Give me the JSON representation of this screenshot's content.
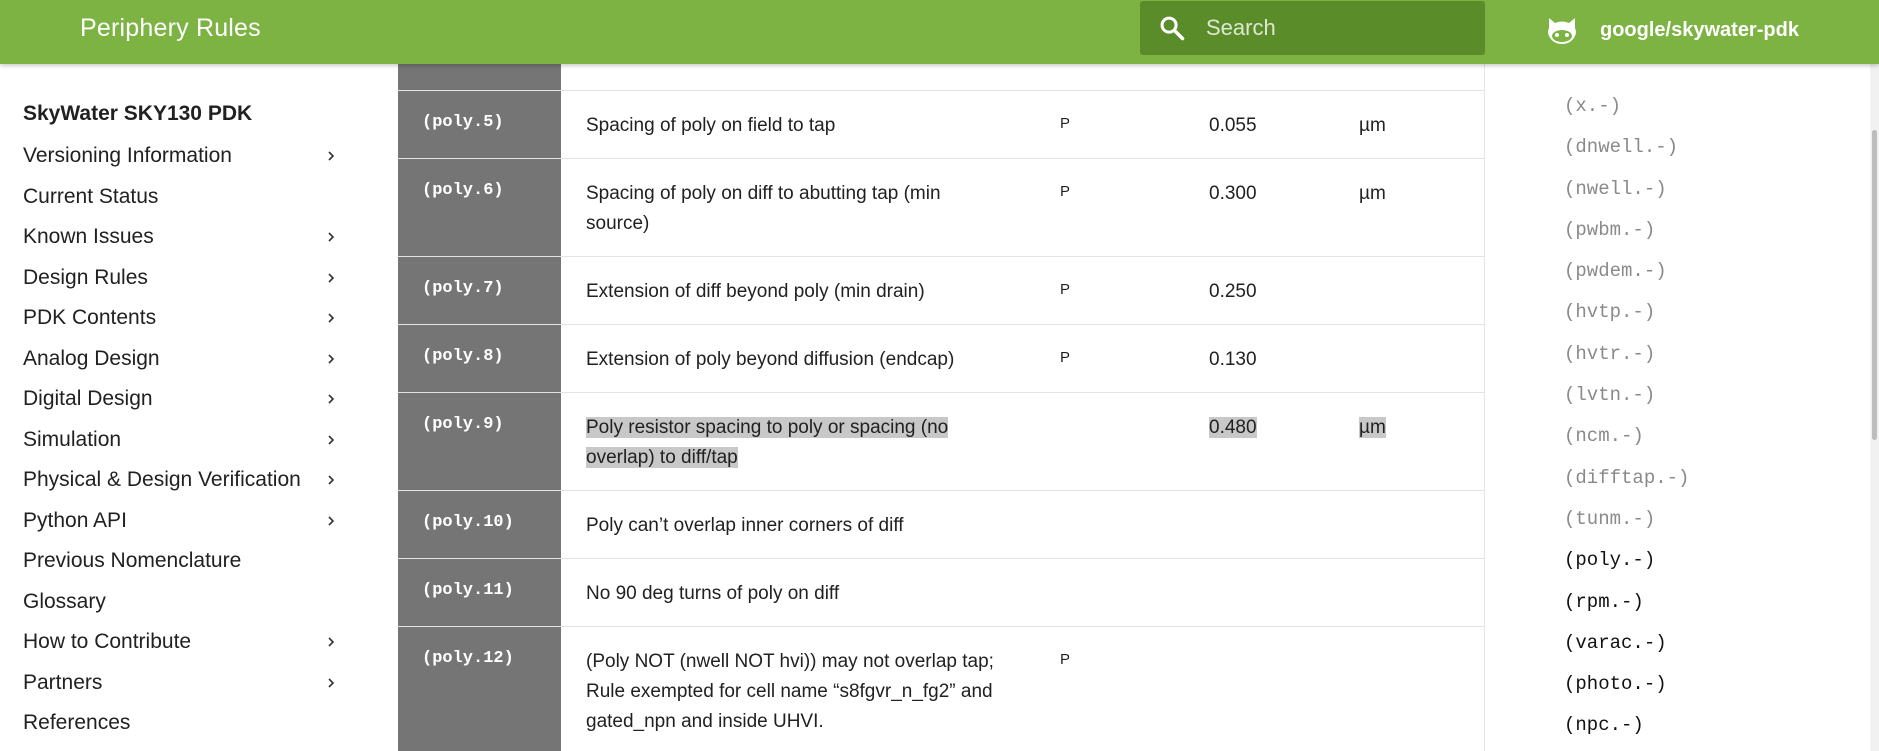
{
  "header": {
    "title": "Periphery Rules",
    "search_placeholder": "Search",
    "repo": "google/skywater-pdk"
  },
  "nav": {
    "site_title": "SkyWater SKY130 PDK",
    "items": [
      {
        "label": "Versioning Information",
        "expandable": true
      },
      {
        "label": "Current Status",
        "expandable": false
      },
      {
        "label": "Known Issues",
        "expandable": true
      },
      {
        "label": "Design Rules",
        "expandable": true
      },
      {
        "label": "PDK Contents",
        "expandable": true
      },
      {
        "label": "Analog Design",
        "expandable": true
      },
      {
        "label": "Digital Design",
        "expandable": true
      },
      {
        "label": "Simulation",
        "expandable": true
      },
      {
        "label": "Physical & Design Verification",
        "expandable": true
      },
      {
        "label": "Python API",
        "expandable": true
      },
      {
        "label": "Previous Nomenclature",
        "expandable": false
      },
      {
        "label": "Glossary",
        "expandable": false
      },
      {
        "label": "How to Contribute",
        "expandable": true
      },
      {
        "label": "Partners",
        "expandable": true
      },
      {
        "label": "References",
        "expandable": false
      }
    ]
  },
  "rules": [
    {
      "id": "(poly.5)",
      "desc": "Spacing of poly on field to tap",
      "flag": "P",
      "value": "0.055",
      "unit": "µm",
      "highlight": false
    },
    {
      "id": "(poly.6)",
      "desc": "Spacing of poly on diff to abutting tap (min source)",
      "flag": "P",
      "value": "0.300",
      "unit": "µm",
      "highlight": false
    },
    {
      "id": "(poly.7)",
      "desc": "Extension of diff beyond poly (min drain)",
      "flag": "P",
      "value": "0.250",
      "unit": "",
      "highlight": false
    },
    {
      "id": "(poly.8)",
      "desc": "Extension of poly beyond diffusion (endcap)",
      "flag": "P",
      "value": "0.130",
      "unit": "",
      "highlight": false
    },
    {
      "id": "(poly.9)",
      "desc": "Poly resistor spacing to poly or spacing (no overlap) to diff/tap",
      "flag": "",
      "value": "0.480",
      "unit": "µm",
      "highlight": true
    },
    {
      "id": "(poly.10)",
      "desc": "Poly can’t overlap inner corners of diff",
      "flag": "",
      "value": "",
      "unit": "",
      "highlight": false
    },
    {
      "id": "(poly.11)",
      "desc": "No 90 deg turns of poly on diff",
      "flag": "",
      "value": "",
      "unit": "",
      "highlight": false
    },
    {
      "id": "(poly.12)",
      "desc": "(Poly NOT (nwell NOT hvi)) may not overlap tap; Rule exempted for cell name “s8fgvr_n_fg2” and gated_npn and inside UHVI.",
      "flag": "P",
      "value": "",
      "unit": "",
      "highlight": false
    }
  ],
  "toc": {
    "items": [
      {
        "label": "(x.-)",
        "active": false
      },
      {
        "label": "(dnwell.-)",
        "active": false
      },
      {
        "label": "(nwell.-)",
        "active": false
      },
      {
        "label": "(pwbm.-)",
        "active": false
      },
      {
        "label": "(pwdem.-)",
        "active": false
      },
      {
        "label": "(hvtp.-)",
        "active": false
      },
      {
        "label": "(hvtr.-)",
        "active": false
      },
      {
        "label": "(lvtn.-)",
        "active": false
      },
      {
        "label": "(ncm.-)",
        "active": false
      },
      {
        "label": "(difftap.-)",
        "active": false
      },
      {
        "label": "(tunm.-)",
        "active": false
      },
      {
        "label": "(poly.-)",
        "active": true
      },
      {
        "label": "(rpm.-)",
        "active": true
      },
      {
        "label": "(varac.-)",
        "active": true
      },
      {
        "label": "(photo.-)",
        "active": true
      },
      {
        "label": "(npc.-)",
        "active": true
      }
    ]
  },
  "colors": {
    "header_bg": "#7cb342",
    "search_bg": "#5b8c2a",
    "rule_col_bg": "#757575",
    "highlight": "#c8c8c8"
  }
}
